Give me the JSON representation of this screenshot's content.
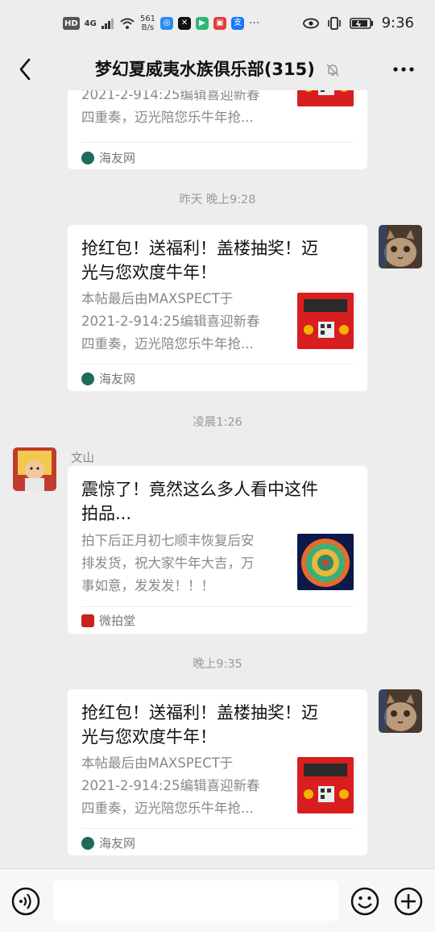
{
  "status_bar": {
    "hd": "HD",
    "network": "4G",
    "speed_value": "561",
    "speed_unit": "B/s",
    "time": "9:36"
  },
  "header": {
    "title": "梦幻夏威夷水族俱乐部(315)",
    "back_icon": "chevron-left-icon",
    "mute_icon": "bell-off-icon",
    "more_icon": "more-dots-icon"
  },
  "messages": [
    {
      "type": "card",
      "side": "right",
      "desc": [
        "2021-2-914:25编辑喜迎新春",
        "四重奏，迈光陪您乐牛年抢..."
      ],
      "source": "海友网"
    },
    {
      "type": "time",
      "text": "昨天 晚上9:28"
    },
    {
      "type": "card",
      "side": "right",
      "title": [
        "抢红包！送福利！盖楼抽奖！迈",
        "光与您欢度牛年！"
      ],
      "desc": [
        "本帖最后由MAXSPECT于",
        "2021-2-914:25编辑喜迎新春",
        "四重奏，迈光陪您乐牛年抢..."
      ],
      "source": "海友网"
    },
    {
      "type": "time",
      "text": "凌晨1:26"
    },
    {
      "type": "card",
      "side": "left",
      "sender": "文山",
      "title": [
        "震惊了！竟然这么多人看中这件",
        "拍品..."
      ],
      "desc": [
        "拍下后正月初七顺丰恢复后安",
        "排发货，祝大家牛年大吉，万",
        "事如意，发发发！！！"
      ],
      "source": "微拍堂"
    },
    {
      "type": "time",
      "text": "晚上9:35"
    },
    {
      "type": "card",
      "side": "right",
      "title": [
        "抢红包！送福利！盖楼抽奖！迈",
        "光与您欢度牛年！"
      ],
      "desc": [
        "本帖最后由MAXSPECT于",
        "2021-2-914:25编辑喜迎新春",
        "四重奏，迈光陪您乐牛年抢..."
      ],
      "source": "海友网"
    }
  ],
  "input_bar": {
    "voice_icon": "voice-icon",
    "emoji_icon": "emoji-icon",
    "plus_icon": "plus-icon",
    "input_value": ""
  },
  "colors": {
    "background": "#ededed",
    "card": "#ffffff",
    "title_text": "#111111",
    "desc_text": "#888888",
    "time_text": "#9a9a9a",
    "red_thumb": "#d81e1e",
    "source_green": "#1f6b5a"
  }
}
